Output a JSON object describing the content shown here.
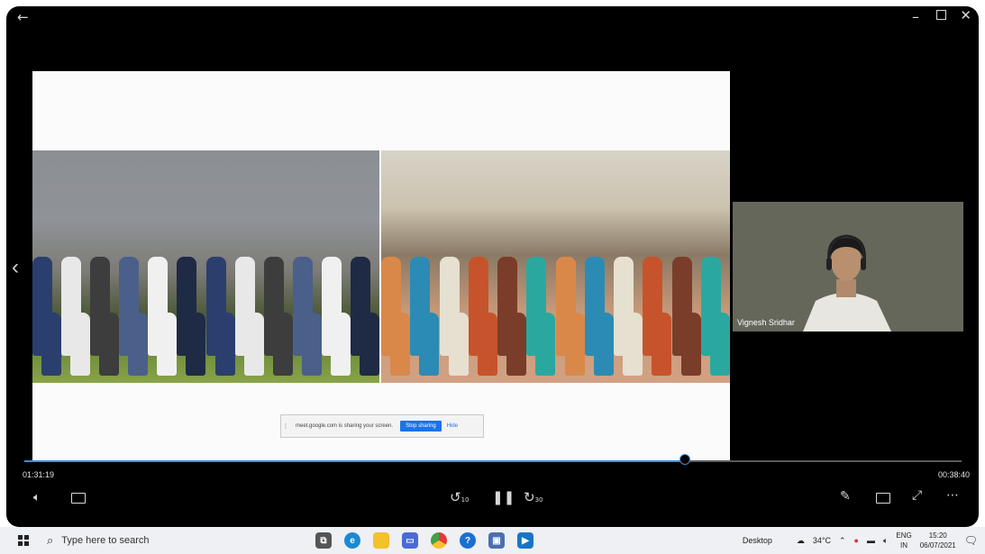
{
  "player": {
    "current_time": "01:31:19",
    "remaining_time": "00:38:40",
    "rewind_label": "10",
    "forward_label": "30",
    "progress_fraction": 0.705,
    "accent_color": "#3a8fdc"
  },
  "share_bar": {
    "message": "meet.google.com is sharing your screen.",
    "stop_label": "Stop sharing",
    "hide_label": "Hide"
  },
  "camera": {
    "participant_name": "Vignesh Sridhar"
  },
  "icons": {
    "back": "back-arrow-icon",
    "minimize": "minimize-icon",
    "maximize": "maximize-icon",
    "close": "close-icon",
    "previous": "chevron-left-icon",
    "volume": "volume-icon",
    "captions": "captions-icon",
    "rewind": "rewind-10-icon",
    "pause": "pause-icon",
    "forward": "forward-30-icon",
    "pen": "pen-icon",
    "miniplayer": "miniplayer-icon",
    "fullscreen": "fullscreen-icon",
    "more": "more-icon"
  },
  "taskbar": {
    "search_placeholder": "Type here to search",
    "desktop_label": "Desktop",
    "weather": "34°C",
    "language_top": "ENG",
    "language_bottom": "IN",
    "clock_time": "15:20",
    "clock_date": "06/07/2021"
  }
}
